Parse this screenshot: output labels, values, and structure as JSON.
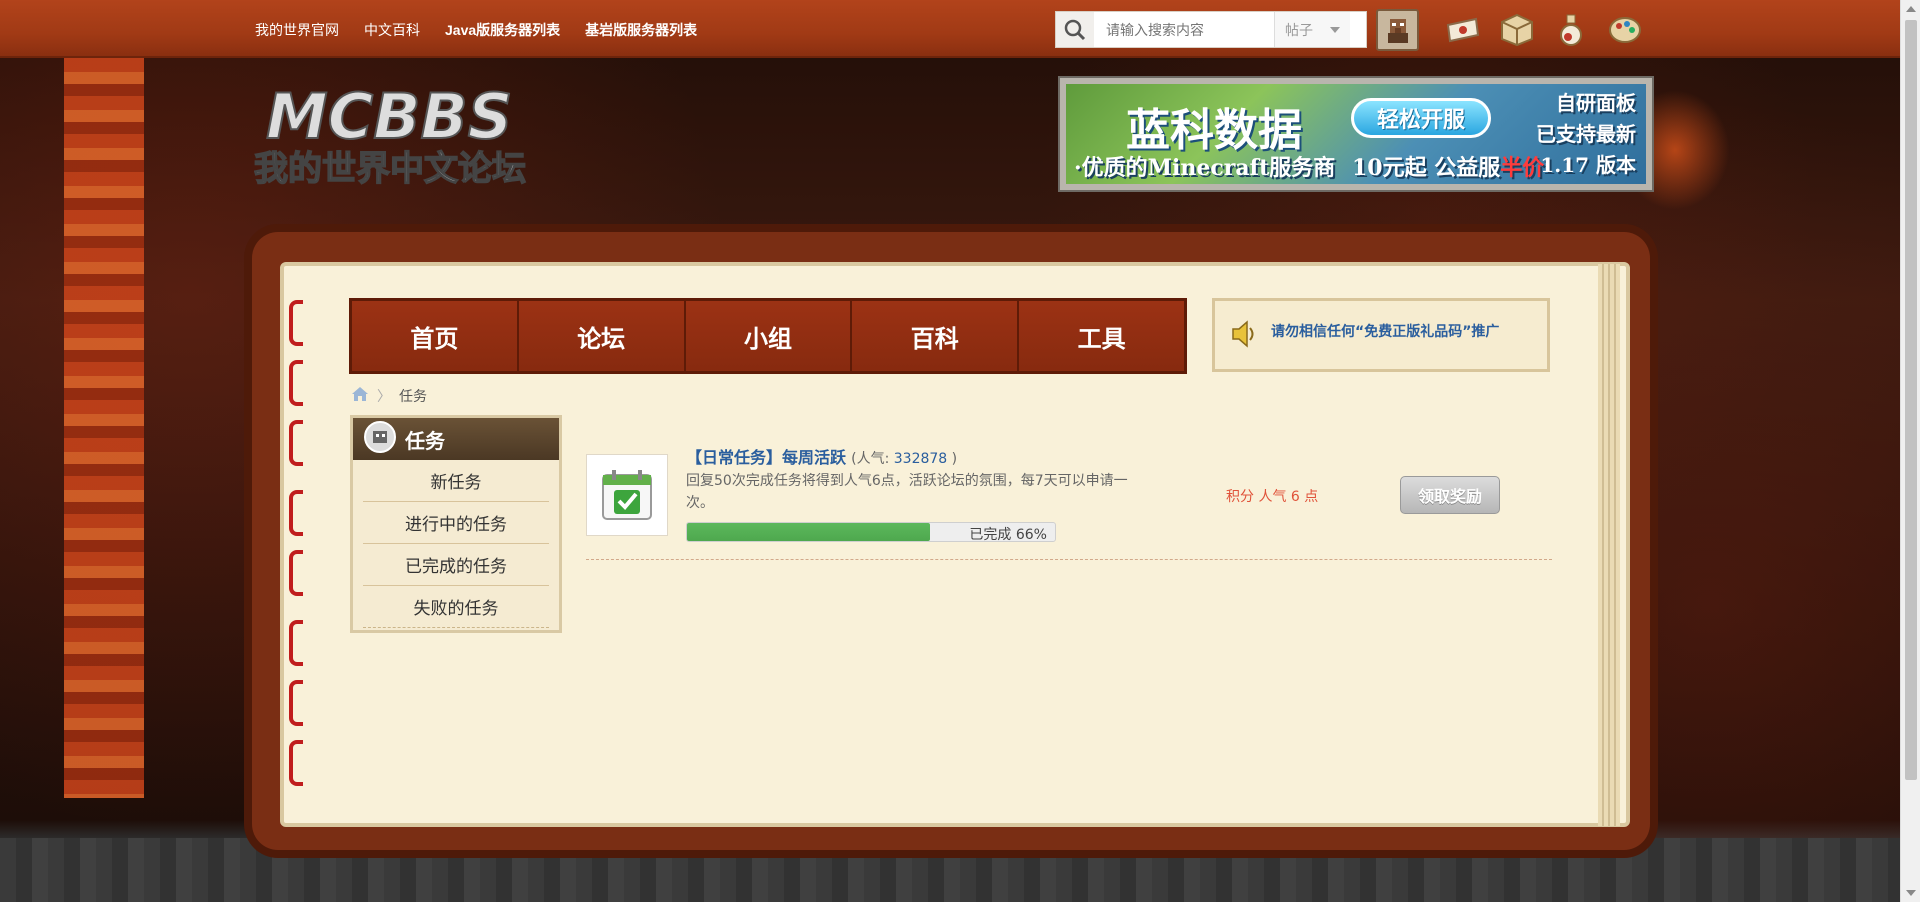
{
  "topbar": {
    "links": [
      {
        "label": "我的世界官网",
        "bold": false
      },
      {
        "label": "中文百科",
        "bold": false
      },
      {
        "label": "Java版服务器列表",
        "bold": true
      },
      {
        "label": "基岩版服务器列表",
        "bold": true
      }
    ],
    "search_placeholder": "请输入搜索内容",
    "search_type": "帖子"
  },
  "logo": {
    "text": "MCBBS",
    "subtitle": "我的世界中文论坛"
  },
  "ad": {
    "title": "蓝科数据",
    "button": "轻松开服",
    "sub": "·优质的Minecraft服务商",
    "price_prefix": "10元起 公益服",
    "price_highlight": "半价",
    "right_line1": "自研面板",
    "right_line2": "已支持最新",
    "right_line3": "1.17 版本"
  },
  "mainnav": {
    "tabs": [
      "首页",
      "论坛",
      "小组",
      "百科",
      "工具"
    ]
  },
  "notice": {
    "text": "请勿相信任何“免费正版礼品码”推广"
  },
  "breadcrumb": {
    "current": "任务"
  },
  "sidebar": {
    "title": "任务",
    "items": [
      "新任务",
      "进行中的任务",
      "已完成的任务",
      "失败的任务"
    ]
  },
  "task": {
    "name": "【日常任务】每周活跃",
    "pop_label": "(人气:",
    "pop_value": "332878",
    "pop_close": ")",
    "desc": "回复50次完成任务将得到人气6点，活跃论坛的氛围，每7天可以申请一次。",
    "progress_label": "已完成 66%",
    "progress": 66,
    "reward": "积分 人气 6 点",
    "claim_label": "领取奖励"
  },
  "colors": {
    "topbar": "#a13a15",
    "nav": "#8a2a10",
    "page": "#f9f1d9",
    "link": "#2a5e9e",
    "reward": "#e0533a",
    "progress": "#5cb85c"
  }
}
